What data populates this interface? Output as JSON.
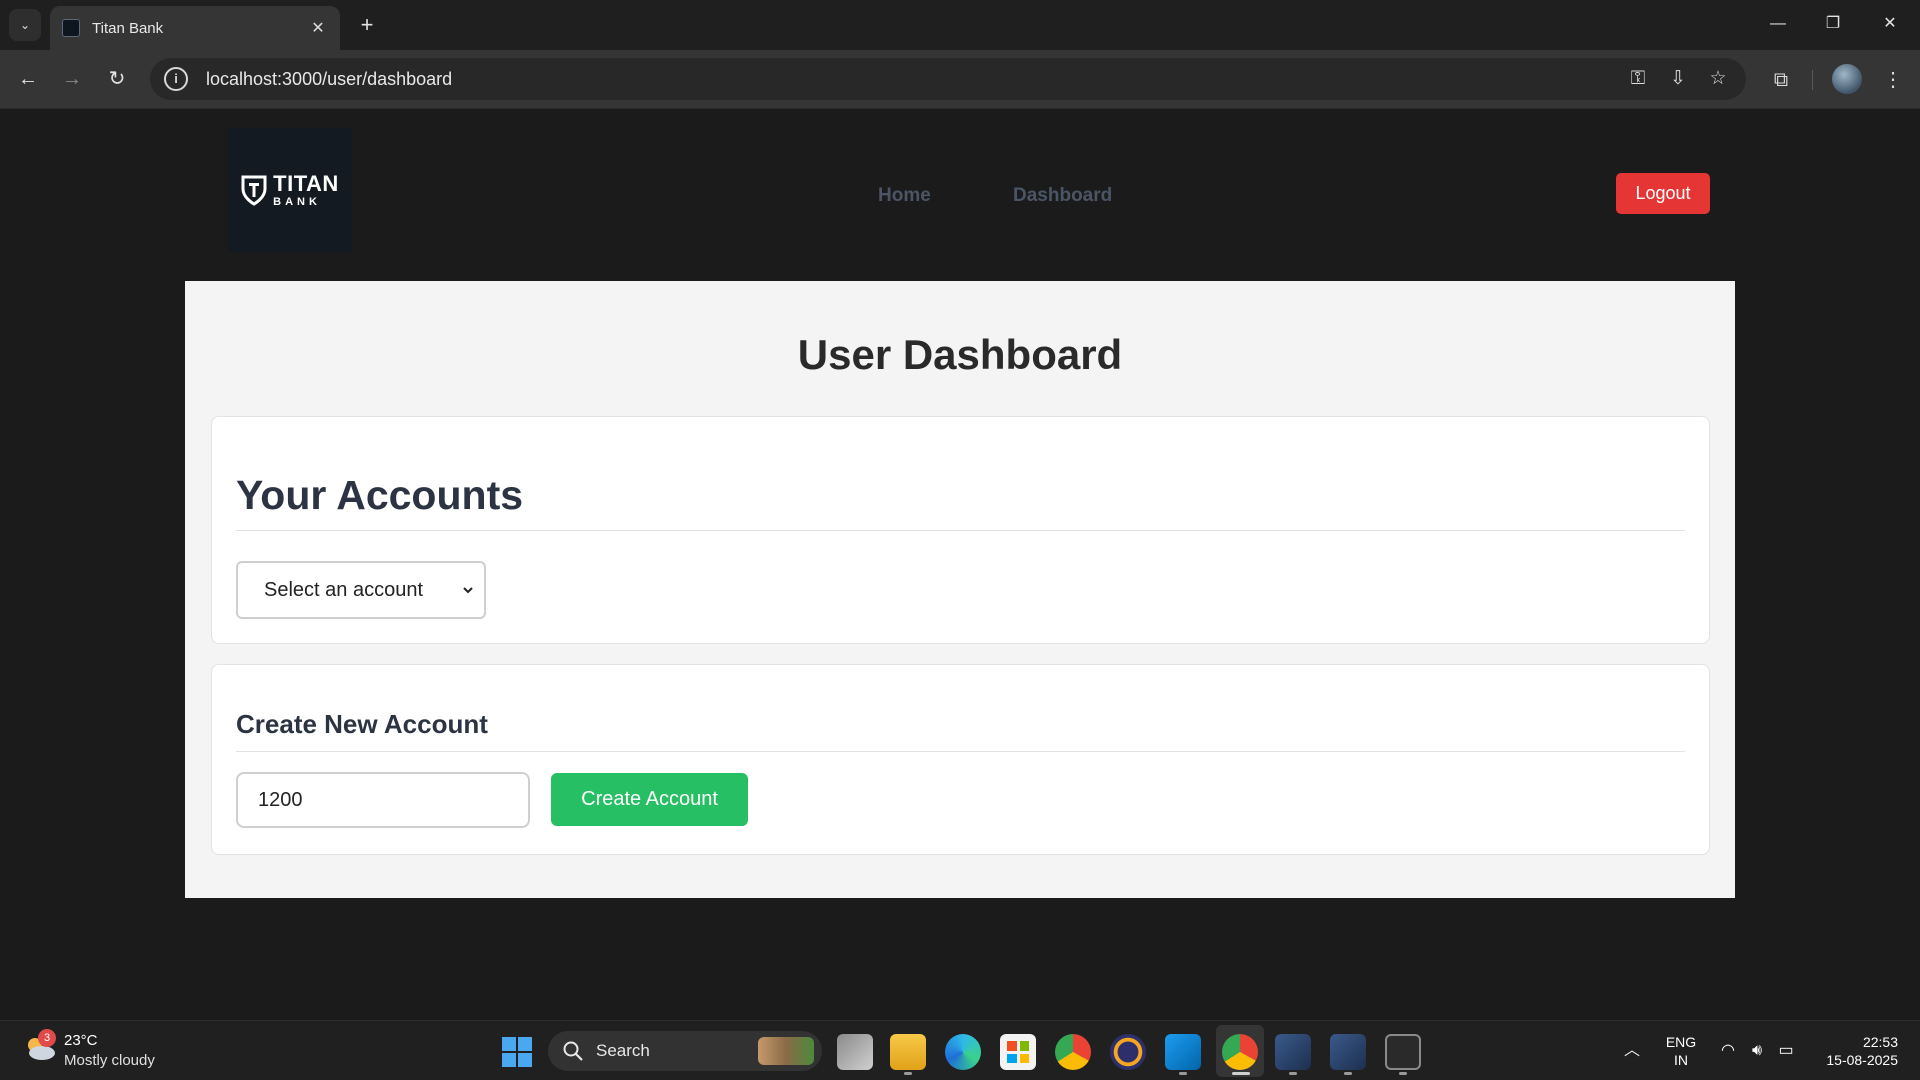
{
  "browser": {
    "tab_title": "Titan Bank",
    "url": "localhost:3000/user/dashboard"
  },
  "site": {
    "logo_title": "TITAN",
    "logo_sub": "BANK",
    "nav": [
      "Home",
      "Dashboard"
    ],
    "logout_label": "Logout"
  },
  "dashboard": {
    "title": "User Dashboard",
    "accounts": {
      "heading": "Your Accounts",
      "select_value": "Select an account"
    },
    "create": {
      "heading": "Create New Account",
      "amount_value": "1200",
      "button_label": "Create Account"
    }
  },
  "taskbar": {
    "weather": {
      "badge": "3",
      "temp": "23°C",
      "desc": "Mostly cloudy"
    },
    "search_label": "Search",
    "lang_line1": "ENG",
    "lang_line2": "IN",
    "time": "22:53",
    "date": "15-08-2025"
  },
  "colors": {
    "logout": "#e53535",
    "create_button": "#26bf63",
    "page_bg": "#1b1b1b",
    "card_bg": "#ffffff"
  }
}
